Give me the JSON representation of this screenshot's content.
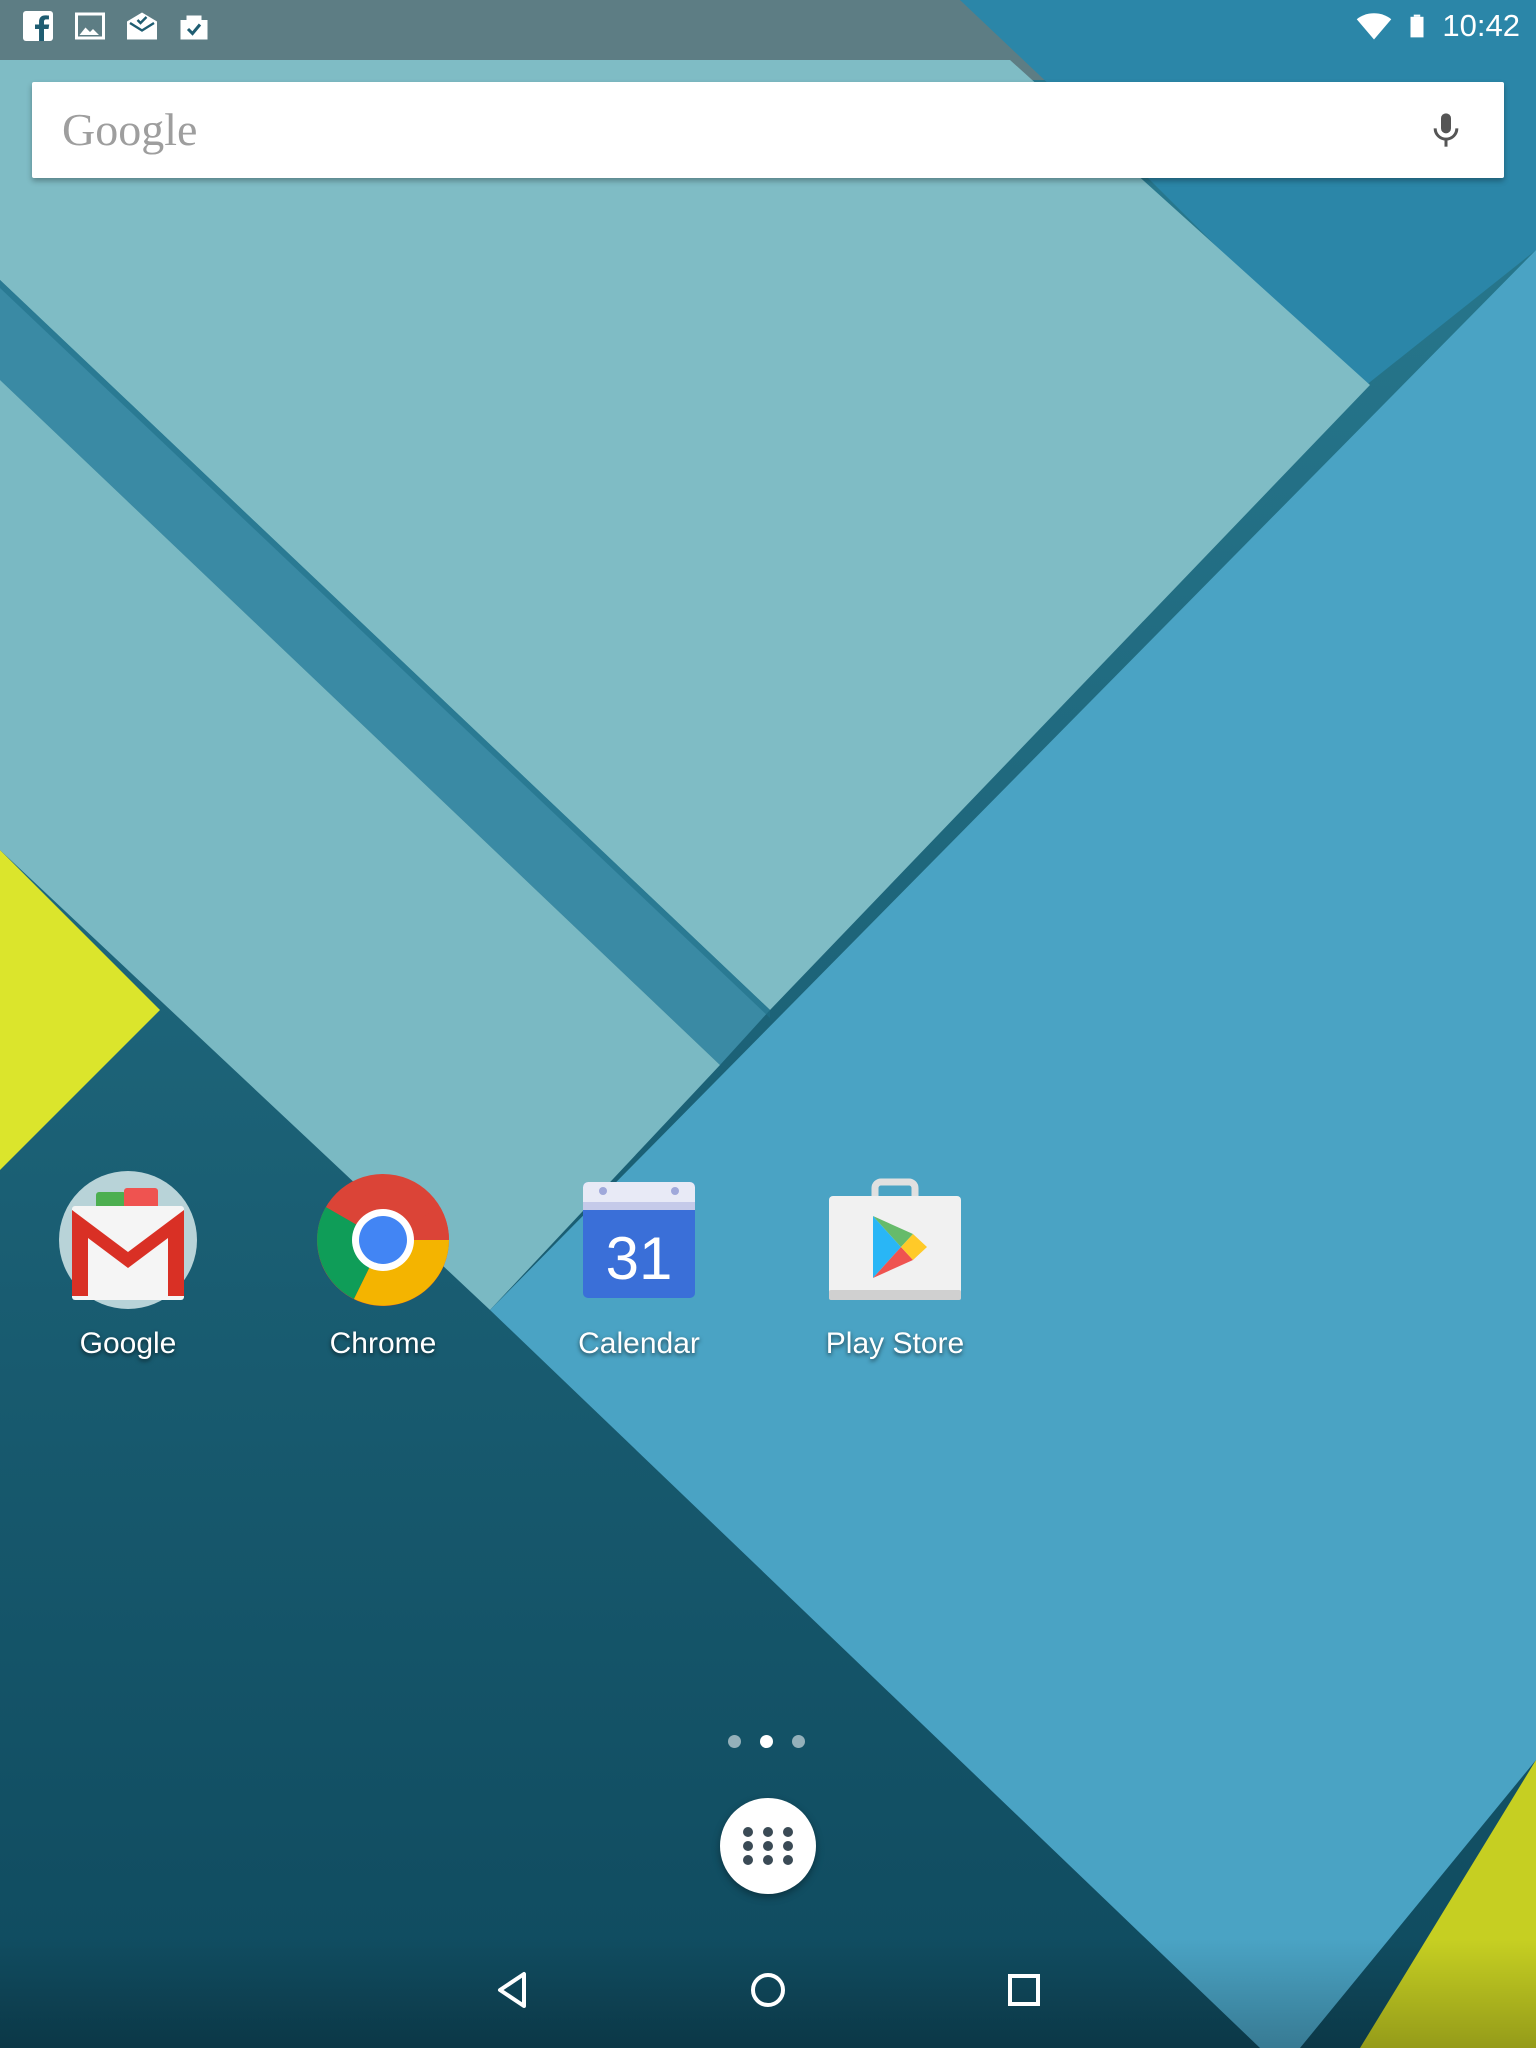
{
  "status_bar": {
    "notification_icons": [
      "facebook-icon",
      "image-icon",
      "email-icon",
      "task-done-icon"
    ],
    "wifi_icon": "wifi-icon",
    "battery_icon": "battery-icon",
    "time": "10:42"
  },
  "search": {
    "logo_text": "Google",
    "mic_icon": "mic-icon"
  },
  "apps": [
    {
      "label": "Google",
      "icon": "gmail-folder-icon"
    },
    {
      "label": "Chrome",
      "icon": "chrome-icon"
    },
    {
      "label": "Calendar",
      "icon": "calendar-icon",
      "icon_text": "31"
    },
    {
      "label": "Play Store",
      "icon": "play-store-icon"
    }
  ],
  "page_indicator": {
    "pages": 3,
    "current": 2
  },
  "all_apps_button": {
    "icon": "app-drawer-icon"
  },
  "nav": {
    "back_icon": "back-icon",
    "home_icon": "home-icon",
    "recents_icon": "recents-icon"
  },
  "colors": {
    "wallpaper_dark_teal": "#14566b",
    "wallpaper_light_teal": "#7fbcc5",
    "wallpaper_blue": "#4ea7c9",
    "wallpaper_yellow": "#d9e32a",
    "calendar_blue": "#4a7fe0"
  }
}
